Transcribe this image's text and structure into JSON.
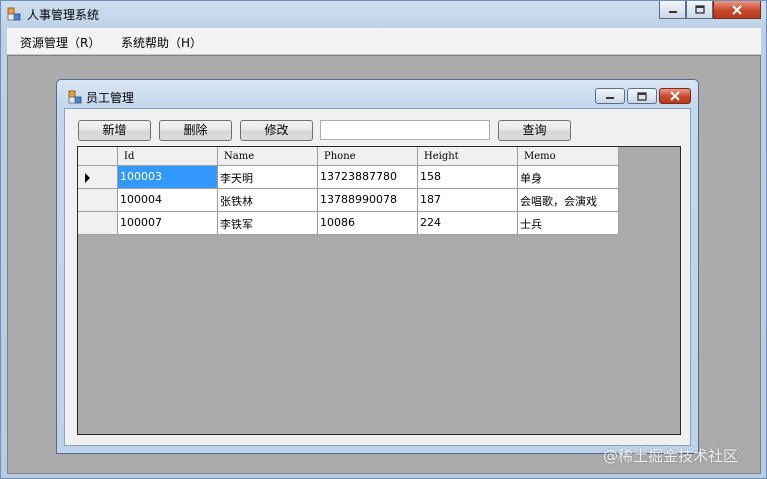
{
  "window": {
    "title": "人事管理系统"
  },
  "menu": {
    "items": [
      "资源管理（R）",
      "系统帮助（H）"
    ]
  },
  "child_window": {
    "title": "员工管理"
  },
  "toolbar": {
    "add_label": "新增",
    "delete_label": "删除",
    "edit_label": "修改",
    "search_value": "",
    "query_label": "查询"
  },
  "grid": {
    "columns": [
      "Id",
      "Name",
      "Phone",
      "Height",
      "Memo"
    ],
    "rows": [
      [
        "100003",
        "李天明",
        "13723887780",
        "158",
        "单身"
      ],
      [
        "100004",
        "张铁林",
        "13788990078",
        "187",
        "会唱歌，会演戏"
      ],
      [
        "100007",
        "李铁军",
        "10086",
        "224",
        "士兵"
      ]
    ],
    "selected_row": 0
  },
  "watermark": "@稀土掘金技术社区"
}
